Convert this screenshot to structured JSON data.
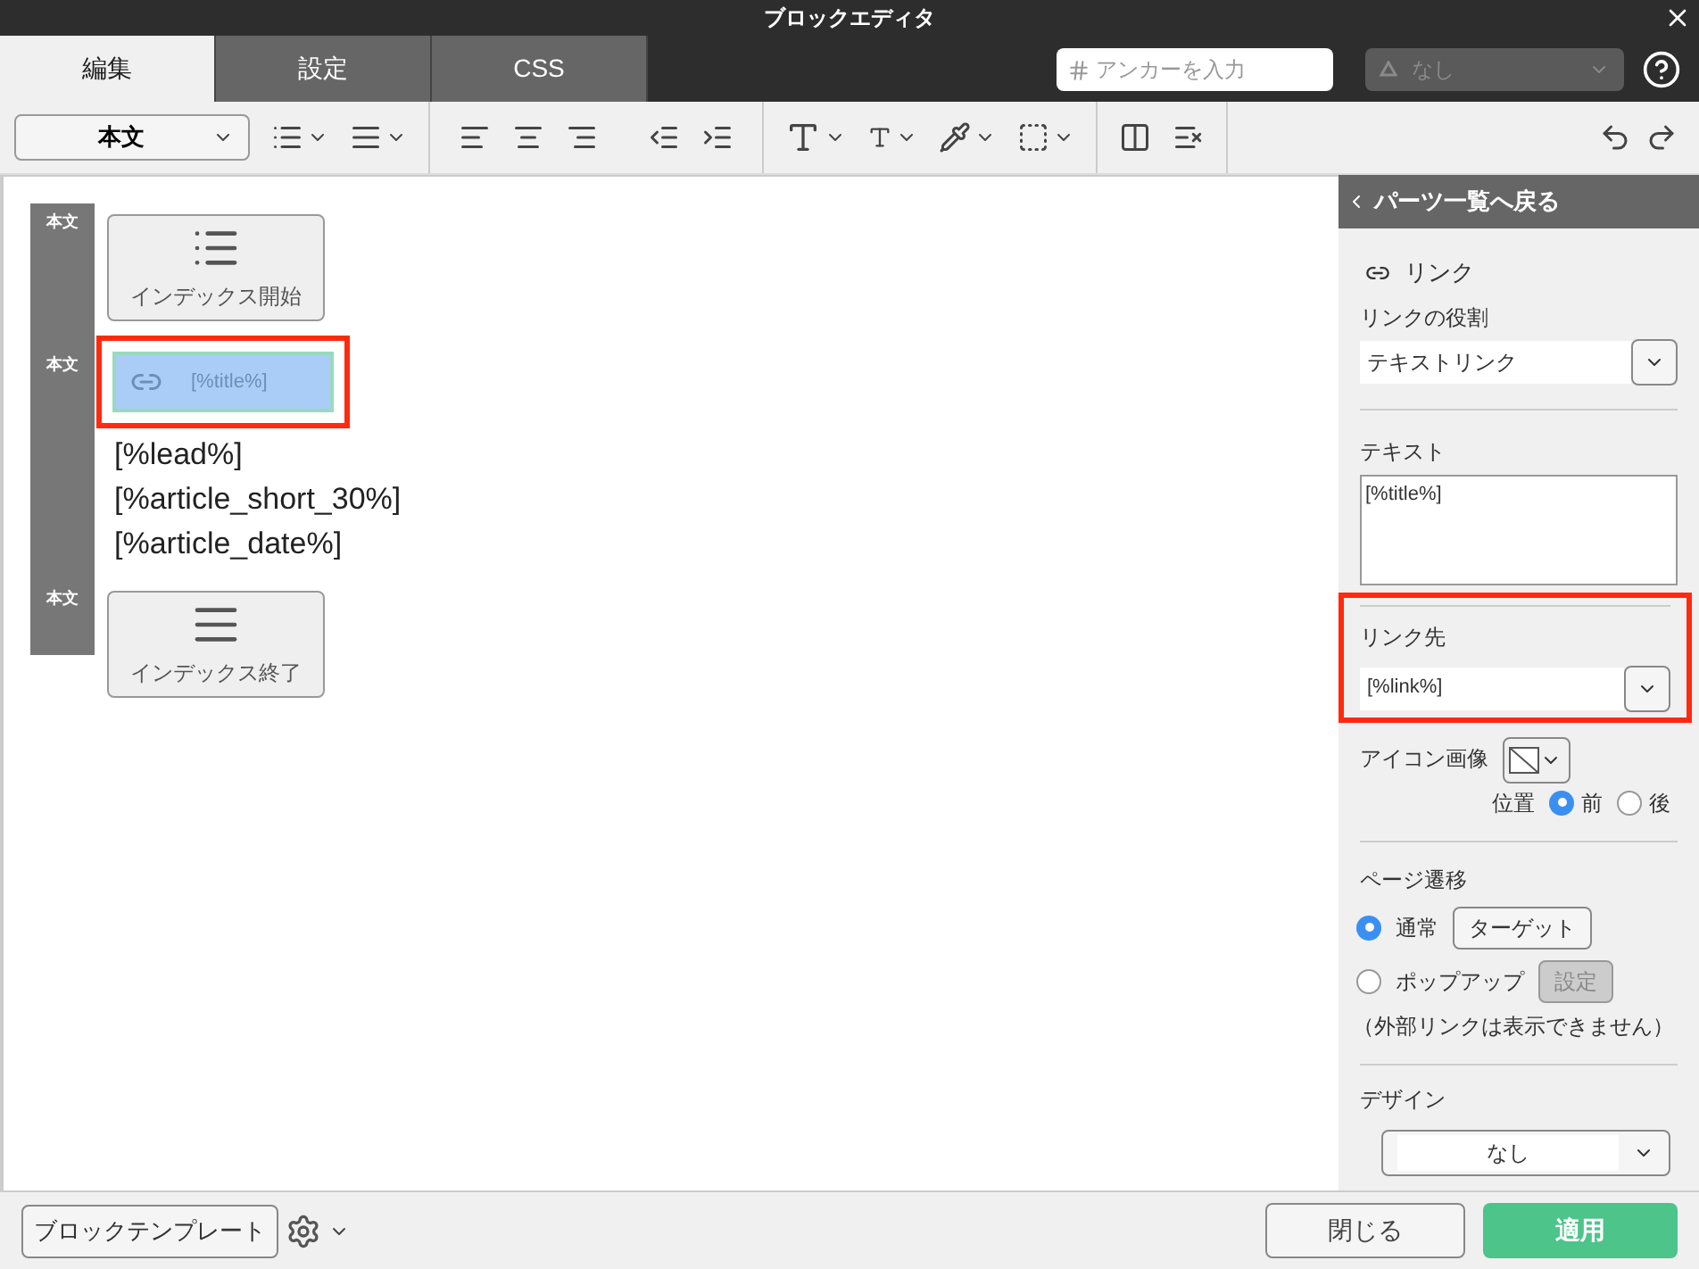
{
  "window": {
    "title": "ブロックエディタ"
  },
  "tabs": [
    {
      "label": "編集",
      "selected": true
    },
    {
      "label": "設定",
      "selected": false
    },
    {
      "label": "CSS",
      "selected": false
    }
  ],
  "anchor_field": {
    "placeholder": "アンカーを入力"
  },
  "class_select": {
    "value": "なし",
    "disabled": true
  },
  "toolbar": {
    "style_select": "本文"
  },
  "canvas": {
    "blocks": [
      {
        "kind": "index_start",
        "tag": "本文",
        "label": "インデックス開始",
        "selected": false
      },
      {
        "kind": "link",
        "tag": "本文",
        "label": "[%title%]",
        "selected": true
      },
      {
        "kind": "text",
        "lines": [
          "[%lead%]",
          "[%article_short_30%]",
          "[%article_date%]"
        ]
      },
      {
        "kind": "index_end",
        "tag": "本文",
        "label": "インデックス終了",
        "selected": false
      }
    ]
  },
  "panel": {
    "back": "パーツ一覧へ戻る",
    "part_title": "リンク",
    "role": {
      "label": "リンクの役割",
      "value": "テキストリンク"
    },
    "text": {
      "label": "テキスト",
      "value": "[%title%]"
    },
    "link_target": {
      "label": "リンク先",
      "value": "[%link%]",
      "highlighted": true
    },
    "icon_image": {
      "label": "アイコン画像"
    },
    "position": {
      "label": "位置",
      "options": [
        {
          "label": "前",
          "selected": true
        },
        {
          "label": "後",
          "selected": false
        }
      ]
    },
    "page_transition": {
      "label": "ページ遷移",
      "options": [
        {
          "label": "通常",
          "selected": true,
          "button": "ターゲット",
          "button_disabled": false
        },
        {
          "label": "ポップアップ",
          "selected": false,
          "button": "設定",
          "button_disabled": true
        }
      ],
      "note": "（外部リンクは表示できません）"
    },
    "design": {
      "label": "デザイン",
      "value": "なし"
    }
  },
  "footer": {
    "template_button": "ブロックテンプレート",
    "close_button": "閉じる",
    "apply_button": "適用"
  }
}
